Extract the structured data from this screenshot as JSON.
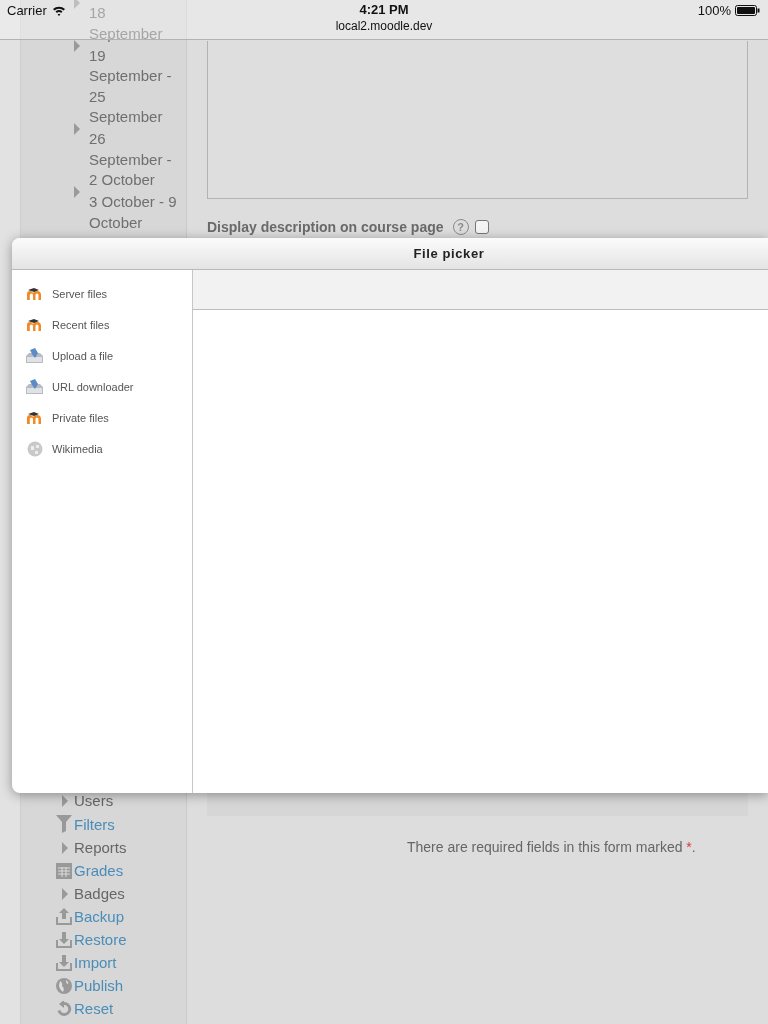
{
  "status_bar": {
    "carrier": "Carrier",
    "time": "4:21 PM",
    "url": "local2.moodle.dev",
    "battery": "100%"
  },
  "sidebar": {
    "weeks": [
      {
        "label": "18 September"
      },
      {
        "label": "19 September - 25 September"
      },
      {
        "label": "26 September - 2 October"
      },
      {
        "label": "3 October - 9 October"
      }
    ],
    "admin_items": [
      {
        "kind": "branch",
        "label": "Users"
      },
      {
        "kind": "filter",
        "label": "Filters"
      },
      {
        "kind": "branch",
        "label": "Reports"
      },
      {
        "kind": "table",
        "label": "Grades"
      },
      {
        "kind": "branch",
        "label": "Badges"
      },
      {
        "kind": "upload",
        "label": "Backup"
      },
      {
        "kind": "download",
        "label": "Restore"
      },
      {
        "kind": "download",
        "label": "Import"
      },
      {
        "kind": "globe",
        "label": "Publish"
      },
      {
        "kind": "reset",
        "label": "Reset"
      }
    ]
  },
  "form": {
    "description_option": {
      "label": "Display description on course page",
      "help": "?",
      "checked": false
    },
    "required_note": {
      "text": "There are required fields in this form marked",
      "mark": "*",
      "end": "."
    }
  },
  "file_picker": {
    "title": "File picker",
    "repositories": [
      {
        "kind": "moodle",
        "label": "Server files"
      },
      {
        "kind": "moodle",
        "label": "Recent files"
      },
      {
        "kind": "upload",
        "label": "Upload a file"
      },
      {
        "kind": "upload",
        "label": "URL downloader"
      },
      {
        "kind": "moodle",
        "label": "Private files"
      },
      {
        "kind": "wiki",
        "label": "Wikimedia"
      }
    ]
  }
}
